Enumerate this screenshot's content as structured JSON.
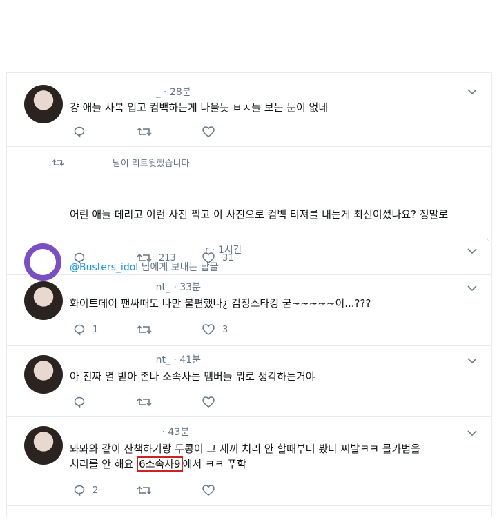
{
  "tweets": [
    {
      "time": "_ · 28분",
      "text": "걍 애들 사복 입고 컴백하는게 나을듯 ㅂㅅ들 보는 눈이 없네",
      "reply_count": "",
      "retweet_count": "",
      "like_count": ""
    },
    {
      "retweet_note": "님이 리트윗했습니다",
      "time": "r · 1시간",
      "reply_to_mention": "@Busters_idol",
      "reply_to_suffix": " 님에게 보내는 답글",
      "text": "어린 애들 데리고 이런 사진 찍고 이 사진으로 컴백 티져를 내는게 최선이셨나요? 정말로",
      "reply_count": "",
      "retweet_count": "213",
      "like_count": "31"
    },
    {
      "time": "nt_ · 33분",
      "text": "화이트데이 팬싸때도 나만 불편했나¿ 검정스타킹 굳~~~~~이...???",
      "reply_count": "1",
      "retweet_count": "",
      "like_count": "3"
    },
    {
      "time": "nt_ · 41분",
      "text": "아 진짜 열 받아 존나 소속사는 멤버들 뭐로 생각하는거야",
      "reply_count": "",
      "retweet_count": "",
      "like_count": ""
    },
    {
      "time": "· 43분",
      "text_line1": "뫄뫄와 같이 산책하기랑 두콩이 그 새끼 처리 안 할때부터 봤다 씨발ㅋㅋ 몰카범을",
      "text_line2_pre": "처리를 안 해요 ",
      "text_highlight": "6소속사9",
      "text_line2_post": "에서 ㅋㅋ 푸학",
      "reply_count": "2",
      "retweet_count": "",
      "like_count": ""
    }
  ],
  "colors": {
    "icon": "#657786",
    "link": "#1b95e0",
    "highlight_box": "#d02020",
    "avatar_ring": "#7b4fc2"
  },
  "icons": [
    "reply-icon",
    "retweet-icon",
    "like-icon",
    "chevron-down-icon"
  ]
}
